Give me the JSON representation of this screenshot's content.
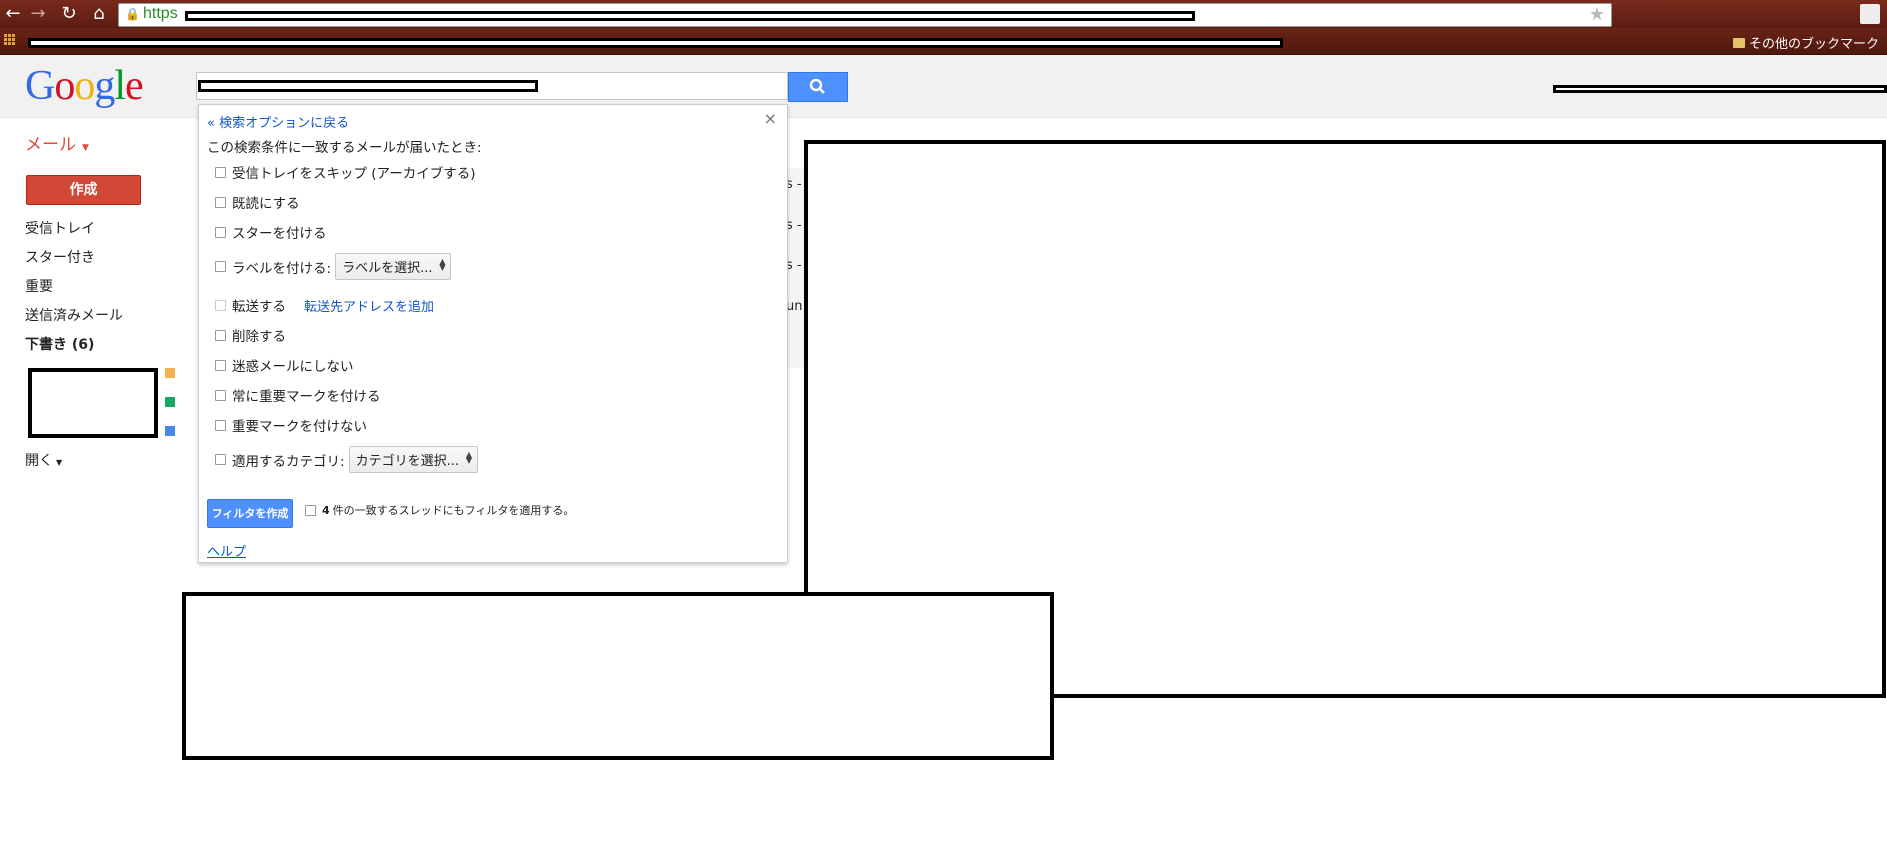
{
  "browser": {
    "url_scheme": "https",
    "bookmark_folder": "その他のブックマーク"
  },
  "header": {
    "logo_letters": [
      {
        "ch": "G",
        "color": "#3369e8"
      },
      {
        "ch": "o",
        "color": "#d50f25"
      },
      {
        "ch": "o",
        "color": "#eeb211"
      },
      {
        "ch": "g",
        "color": "#3369e8"
      },
      {
        "ch": "l",
        "color": "#009925"
      },
      {
        "ch": "e",
        "color": "#d50f25"
      }
    ]
  },
  "sidebar": {
    "mail_label": "メール",
    "compose_label": "作成",
    "items": [
      {
        "label": "受信トレイ"
      },
      {
        "label": "スター付き"
      },
      {
        "label": "重要"
      },
      {
        "label": "送信済みメール"
      },
      {
        "label": "下書き (6)"
      }
    ],
    "label_colors": [
      "#f6b04f",
      "#16a765",
      "#4986e7"
    ],
    "more_label": "開く"
  },
  "filter_dialog": {
    "back_link": "« 検索オプションに戻る",
    "heading": "この検索条件に一致するメールが届いたとき:",
    "options": {
      "skip_inbox": "受信トレイをスキップ (アーカイブする)",
      "mark_read": "既読にする",
      "star_it": "スターを付ける",
      "apply_label": "ラベルを付ける:",
      "label_select": "ラベルを選択...",
      "forward": "転送する",
      "add_forward": "転送先アドレスを追加",
      "delete": "削除する",
      "never_spam": "迷惑メールにしない",
      "always_important": "常に重要マークを付ける",
      "never_important": "重要マークを付けない",
      "category": "適用するカテゴリ:",
      "category_select": "カテゴリを選択..."
    },
    "create_button": "フィルタを作成",
    "apply_count": "4",
    "apply_text": "件の一致するスレッドにもフィルタを適用する。",
    "help_link": "ヘルプ"
  },
  "background_list": {
    "row_fragments": [
      "s -",
      "s -",
      "s -",
      "un"
    ]
  }
}
